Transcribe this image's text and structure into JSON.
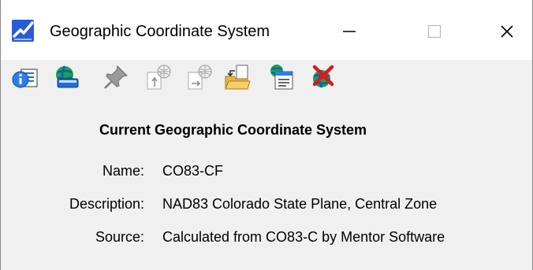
{
  "window": {
    "title": "Geographic Coordinate System",
    "controls": [
      "minimize-icon",
      "maximize-icon",
      "close-icon"
    ]
  },
  "toolbar": {
    "icons": [
      "properties-info-icon",
      "select-from-library-icon",
      "pin-icon",
      "import-coordinate-system-icon",
      "export-coordinate-system-icon",
      "open-folder-icon",
      "coordinate-report-icon",
      "delete-coordinate-system-icon"
    ]
  },
  "content": {
    "heading": "Current Geographic Coordinate System",
    "name_label": "Name:",
    "name_value": "CO83-CF",
    "description_label": "Description:",
    "description_value": "NAD83 Colorado State Plane, Central Zone",
    "source_label": "Source:",
    "source_value": "Calculated from CO83-C by Mentor Software"
  },
  "colors": {
    "window_background": "#f0f0f0",
    "titlebar_background": "#ffffff",
    "icon_blue": "#1e6fd9",
    "icon_red": "#d81b1b"
  }
}
